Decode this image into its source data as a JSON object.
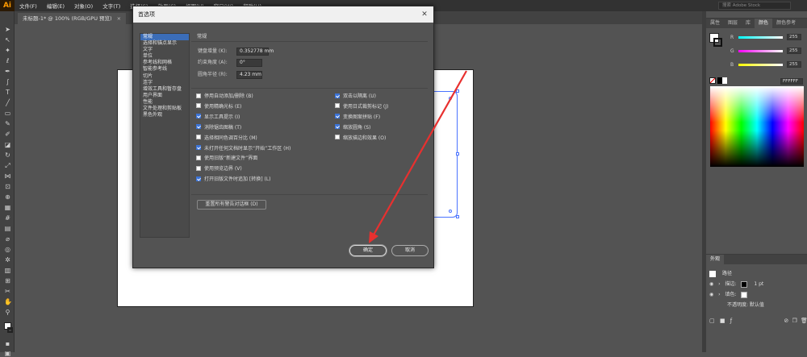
{
  "app": {
    "logo": "Ai",
    "search_placeholder": "搜索 Adobe Stock"
  },
  "menubar": [
    "文件(F)",
    "编辑(E)",
    "对象(O)",
    "文字(T)",
    "选择(S)",
    "效果(C)",
    "视图(V)",
    "窗口(W)",
    "帮助(H)"
  ],
  "document_tab": {
    "label": "未标题-1* @ 100% (RGB/GPU 预览)",
    "close": "×"
  },
  "dialog": {
    "title": "首选项",
    "categories": [
      "常规",
      "选择和锚点显示",
      "文字",
      "单位",
      "参考线和网格",
      "智能参考线",
      "切片",
      "连字",
      "增效工具和暂存盘",
      "用户界面",
      "性能",
      "文件处理和剪贴板",
      "黑色外观"
    ],
    "selected_category": "常规",
    "section_title": "常规",
    "fields": [
      {
        "label": "键盘增量 (K):",
        "value": "0.352778 mm"
      },
      {
        "label": "约束角度 (A):",
        "value": "0°"
      },
      {
        "label": "圆角半径 (R):",
        "value": "4.23 mm"
      }
    ],
    "checkboxes_left": [
      {
        "label": "停用自动添加/删除 (B)",
        "checked": false
      },
      {
        "label": "使用精确光标 (E)",
        "checked": false
      },
      {
        "label": "显示工具提示 (I)",
        "checked": true
      },
      {
        "label": "消除锯齿图稿 (T)",
        "checked": true
      },
      {
        "label": "选择相同色调百分比 (M)",
        "checked": false
      },
      {
        "label": "未打开任何文档时显示“开始”工作区 (H)",
        "checked": true
      },
      {
        "label": "使用旧版“新建文件”界面",
        "checked": false
      },
      {
        "label": "使用预览边界 (V)",
        "checked": false
      },
      {
        "label": "打开旧版文件时追加 [转换] (L)",
        "checked": true
      }
    ],
    "checkboxes_right": [
      {
        "label": "双击以隔离 (U)",
        "checked": true
      },
      {
        "label": "使用日式裁剪标记 (J)",
        "checked": false
      },
      {
        "label": "变换图案拼贴 (F)",
        "checked": true
      },
      {
        "label": "缩放圆角 (S)",
        "checked": true
      },
      {
        "label": "缩放描边和效果 (O)",
        "checked": false
      }
    ],
    "reset_button": "重置所有警告对话框 (D)",
    "ok_button": "确定",
    "cancel_button": "取消"
  },
  "color_panel": {
    "tabs": [
      "属性",
      "图层",
      "库",
      "颜色",
      "颜色参考"
    ],
    "active_tab": "颜色",
    "channels": [
      {
        "label": "R",
        "value": "255"
      },
      {
        "label": "G",
        "value": "255"
      },
      {
        "label": "B",
        "value": "255"
      }
    ],
    "hex_value": "FFFFFF"
  },
  "appearance_panel": {
    "title": "外观",
    "object": "路径",
    "stroke_label": "描边:",
    "stroke_value": "1 pt",
    "fill_label": "填色:",
    "opacity_label": "不透明度: 默认值"
  },
  "colors": {
    "accent": "#3c74d8",
    "arrow": "#e8302f",
    "selection": "#4a73ff"
  }
}
